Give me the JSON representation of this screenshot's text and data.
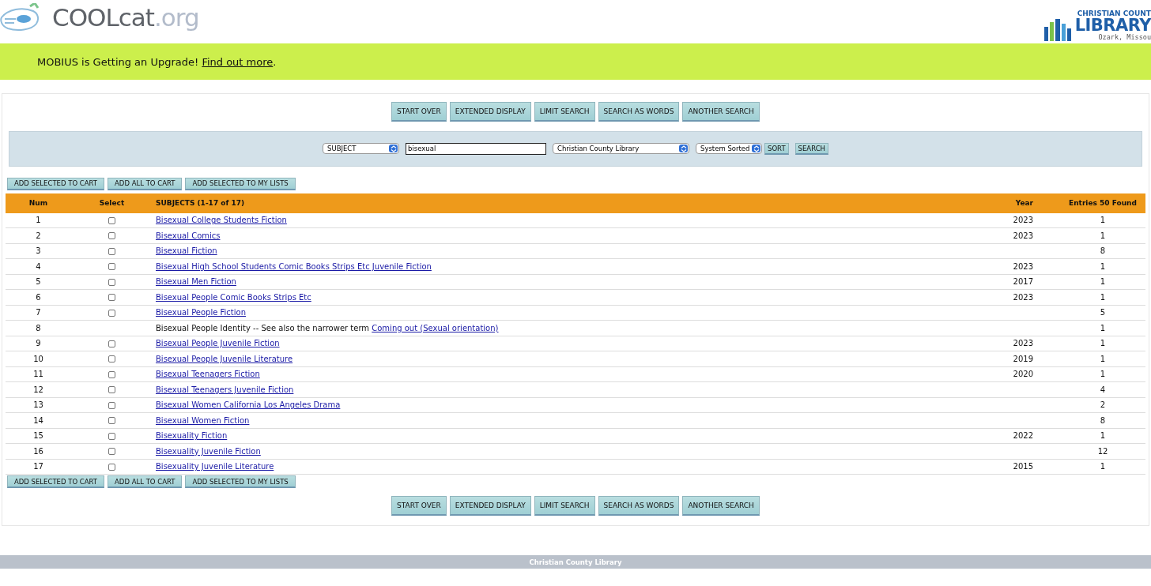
{
  "header": {
    "logo": {
      "main": "COOLcat",
      "suffix": ".org"
    },
    "library_logo": {
      "line1": "CHRISTIAN COUNT",
      "line2": "LIBRARY",
      "line3": "Ozark, Missou"
    }
  },
  "banner": {
    "text": "MOBIUS is Getting an Upgrade!",
    "link": "Find out more",
    "after": "."
  },
  "nav_buttons": [
    "START OVER",
    "EXTENDED DISPLAY",
    "LIMIT SEARCH",
    "SEARCH AS WORDS",
    "ANOTHER SEARCH"
  ],
  "search": {
    "field": "SUBJECT",
    "query": "bisexual",
    "scope": "Christian County Library",
    "sort": "System Sorted",
    "sort_button": "SORT",
    "search_button": "SEARCH"
  },
  "actions": [
    "ADD SELECTED TO CART",
    "ADD ALL TO CART",
    "ADD SELECTED TO MY LISTS"
  ],
  "table": {
    "columns": [
      "Num",
      "Select",
      "SUBJECTS (1-17 of 17)",
      "Year",
      "Entries 50 Found"
    ],
    "rows": [
      {
        "kind": "link",
        "num": "1",
        "checked": false,
        "subject": "Bisexual College Students Fiction",
        "year": "2023",
        "entries": "1"
      },
      {
        "kind": "link",
        "num": "2",
        "checked": false,
        "subject": "Bisexual Comics",
        "year": "2023",
        "entries": "1"
      },
      {
        "kind": "link",
        "num": "3",
        "checked": false,
        "subject": "Bisexual Fiction",
        "entries": "8"
      },
      {
        "kind": "link",
        "num": "4",
        "checked": false,
        "subject": "Bisexual High School Students Comic Books Strips Etc Juvenile Fiction",
        "year": "2023",
        "entries": "1"
      },
      {
        "kind": "link",
        "num": "5",
        "checked": false,
        "subject": "Bisexual Men Fiction",
        "year": "2017",
        "entries": "1"
      },
      {
        "kind": "link",
        "num": "6",
        "checked": false,
        "subject": "Bisexual People Comic Books Strips Etc",
        "year": "2023",
        "entries": "1"
      },
      {
        "kind": "link",
        "num": "7",
        "checked": false,
        "subject": "Bisexual People Fiction",
        "entries": "5"
      },
      {
        "kind": "note",
        "num": "8",
        "subject": "Bisexual People Identity -- See also the narrower term",
        "link": "Coming out (Sexual orientation)",
        "entries": "1"
      },
      {
        "kind": "link",
        "num": "9",
        "checked": false,
        "subject": "Bisexual People Juvenile Fiction",
        "year": "2023",
        "entries": "1"
      },
      {
        "kind": "link",
        "num": "10",
        "checked": false,
        "subject": "Bisexual People Juvenile Literature",
        "year": "2019",
        "entries": "1"
      },
      {
        "kind": "link",
        "num": "11",
        "checked": false,
        "subject": "Bisexual Teenagers Fiction",
        "year": "2020",
        "entries": "1"
      },
      {
        "kind": "link",
        "num": "12",
        "checked": false,
        "subject": "Bisexual Teenagers Juvenile Fiction",
        "entries": "4"
      },
      {
        "kind": "link",
        "num": "13",
        "checked": false,
        "subject": "Bisexual Women California Los Angeles Drama",
        "entries": "2"
      },
      {
        "kind": "link",
        "num": "14",
        "checked": false,
        "subject": "Bisexual Women Fiction",
        "entries": "8"
      },
      {
        "kind": "link",
        "num": "15",
        "checked": false,
        "subject": "Bisexuality Fiction",
        "year": "2022",
        "entries": "1"
      },
      {
        "kind": "link",
        "num": "16",
        "checked": false,
        "subject": "Bisexuality Juvenile Fiction",
        "entries": "12"
      },
      {
        "kind": "link",
        "num": "17",
        "checked": false,
        "subject": "Bisexuality Juvenile Literature",
        "year": "2015",
        "entries": "1"
      }
    ]
  },
  "actions_bottom": [
    "ADD SELECTED TO CART",
    "ADD ALL TO CART",
    "ADD SELECTED TO MY LISTS"
  ],
  "nav_buttons_bottom": [
    "START OVER",
    "EXTENDED DISPLAY",
    "LIMIT SEARCH",
    "SEARCH AS WORDS",
    "ANOTHER SEARCH"
  ],
  "footer": {
    "text": "Christian County Library"
  }
}
